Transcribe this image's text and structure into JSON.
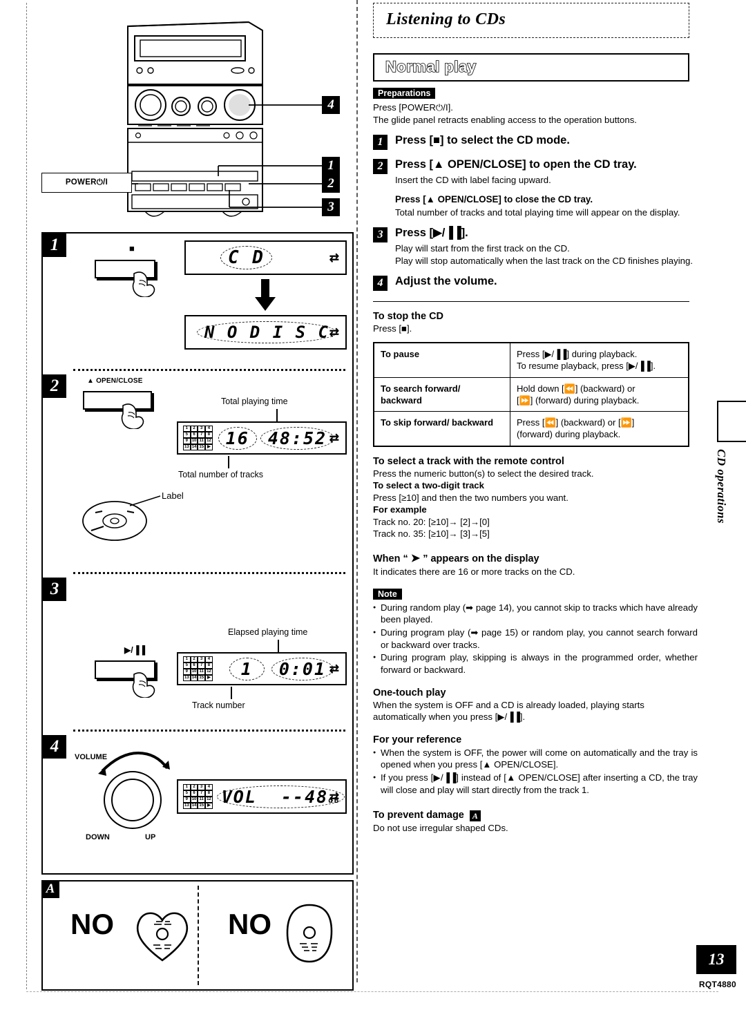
{
  "page": {
    "number": "13",
    "doc_code": "RQT4880",
    "side_tab_label": "CD operations"
  },
  "header": {
    "title": "Listening to CDs",
    "section": "Normal play"
  },
  "preparations": {
    "tag": "Preparations",
    "line1": "Press [POWER⏻/I].",
    "line2": "The glide panel retracts enabling access to the operation buttons."
  },
  "steps": [
    {
      "num": "1",
      "head": "Press [■] to select the CD mode.",
      "subs": []
    },
    {
      "num": "2",
      "head": "Press [▲ OPEN/CLOSE] to open the CD tray.",
      "subs": [
        "Insert the CD with label facing upward."
      ],
      "bold_line": "Press [▲ OPEN/CLOSE] to close the CD tray.",
      "after_bold": "Total number of tracks and total playing time will appear on the display."
    },
    {
      "num": "3",
      "head": "Press [▶/▐▐].",
      "subs": [
        "Play will start from the first track on the CD.",
        "Play will stop automatically when the last track on the CD finishes playing."
      ]
    },
    {
      "num": "4",
      "head": "Adjust the volume.",
      "subs": []
    }
  ],
  "stop_section": {
    "heading": "To stop the CD",
    "text": "Press [■]."
  },
  "ops_table": {
    "rows": [
      {
        "label": "To pause",
        "lines": [
          "Press [▶/▐▐] during playback.",
          "To resume playback, press [▶/▐▐]."
        ]
      },
      {
        "label": "To search forward/ backward",
        "lines": [
          "Hold down [⏪] (backward) or",
          "[⏩] (forward) during playback."
        ]
      },
      {
        "label": "To skip forward/ backward",
        "lines": [
          "Press [⏪] (backward) or [⏩]",
          "(forward) during playback."
        ]
      }
    ]
  },
  "remote_section": {
    "heading": "To select a track with the remote control",
    "line1": "Press the numeric button(s) to select the desired track.",
    "sub_heading": "To select a two-digit track",
    "line2": "Press [≥10] and then the two numbers you want.",
    "example_heading": "For example",
    "example1": "Track no. 20:  [≥10]→ [2]→[0]",
    "example2": "Track no. 35:  [≥10]→ [3]→[5]"
  },
  "display_arrow_section": {
    "heading_pre": "When “ ",
    "heading_icon": "➤",
    "heading_post": " ” appears on the display",
    "text": "It indicates there are 16 or more tracks on the CD."
  },
  "note": {
    "tag": "Note",
    "items": [
      "During random play (➡ page 14), you cannot skip to tracks which have already been played.",
      "During program play (➡ page 15) or random play, you cannot search forward or backward over tracks.",
      "During program play, skipping is always in the programmed order, whether forward or backward."
    ]
  },
  "one_touch": {
    "heading": "One-touch play",
    "text": "When the system is OFF and a CD is already loaded, playing starts automatically when you press [▶/▐▐]."
  },
  "reference": {
    "heading": "For your reference",
    "items": [
      "When the system is OFF, the power will come on automatically and the tray is opened when you press [▲ OPEN/CLOSE].",
      "If you press [▶/▐▐] instead of [▲ OPEN/CLOSE] after inserting a CD, the tray will close and play will start directly from the track 1."
    ]
  },
  "prevent_damage": {
    "heading": "To prevent damage",
    "badge": "A",
    "text": "Do not use irregular shaped CDs."
  },
  "illustrations": {
    "device": {
      "power_label": "POWER⏻/I",
      "callouts": [
        "4",
        "1",
        "2",
        "3"
      ]
    },
    "step1": {
      "badge": "1",
      "button_label": "■",
      "display_a": "C D",
      "display_b": "N O   D I S C",
      "repeat_icon": "⇄"
    },
    "step2": {
      "badge": "2",
      "button_label": "▲ OPEN/CLOSE",
      "annot_top": "Total playing time",
      "annot_bottom": "Total number of tracks",
      "track_count": "16",
      "total_time": "48:52",
      "disc_label": "Label",
      "repeat_icon": "⇄"
    },
    "step3": {
      "badge": "3",
      "button_label": "▶/▐▐",
      "annot_top": "Elapsed playing time",
      "annot_bottom": "Track number",
      "track_no": "1",
      "elapsed": "0:01",
      "repeat_icon": "⇄"
    },
    "step4": {
      "badge": "4",
      "volume_label": "VOLUME",
      "down_label": "DOWN",
      "up_label": "UP",
      "display_text": "VOL",
      "display_value": "--48",
      "display_unit": "dB",
      "repeat_icon": "⇄"
    },
    "panel_a": {
      "badge": "A",
      "no_left": "NO",
      "no_right": "NO"
    },
    "track_grid": [
      "1",
      "2",
      "3",
      "4",
      "5",
      "6",
      "7",
      "8",
      "9",
      "10",
      "11",
      "12",
      "13",
      "14",
      "15",
      "▶"
    ]
  }
}
